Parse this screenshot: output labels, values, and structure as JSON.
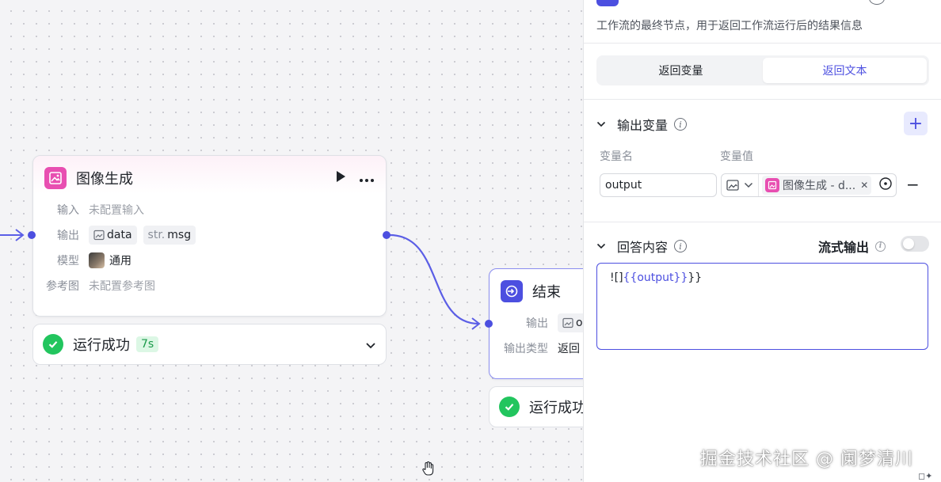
{
  "canvas": {
    "image_node": {
      "title": "图像生成",
      "input_label": "输入",
      "input_value": "未配置输入",
      "output_label": "输出",
      "output_tag_1": "data",
      "output_tag_2_prefix": "str.",
      "output_tag_2": "msg",
      "model_label": "模型",
      "model_value": "通用",
      "ref_label": "参考图",
      "ref_value": "未配置参考图",
      "status": "运行成功",
      "time": "7s"
    },
    "end_node": {
      "title": "结束",
      "output_label": "输出",
      "output_tag": "o",
      "output_type_label": "输出类型",
      "output_type_value": "返回",
      "status": "运行成功"
    }
  },
  "panel": {
    "description": "工作流的最终节点，用于返回工作流运行后的结果信息",
    "tabs": [
      "返回变量",
      "返回文本"
    ],
    "active_tab": "返回文本",
    "output_section": {
      "title": "输出变量",
      "col_name": "变量名",
      "col_value": "变量值",
      "var_name": "output",
      "var_ref": "图像生成 - d...",
      "remove": "−",
      "add": "+"
    },
    "answer_section": {
      "title": "回答内容",
      "stream_label": "流式输出",
      "stream_enabled": false,
      "content_prefix": "![]",
      "content_var": "{{output}}",
      "content_suffix": "}}"
    }
  },
  "watermark": "掘金技术社区 @ 阑梦清川",
  "colors": {
    "accent": "#4c4fe0",
    "image_icon": "#e84fb1",
    "success": "#22c55e"
  }
}
